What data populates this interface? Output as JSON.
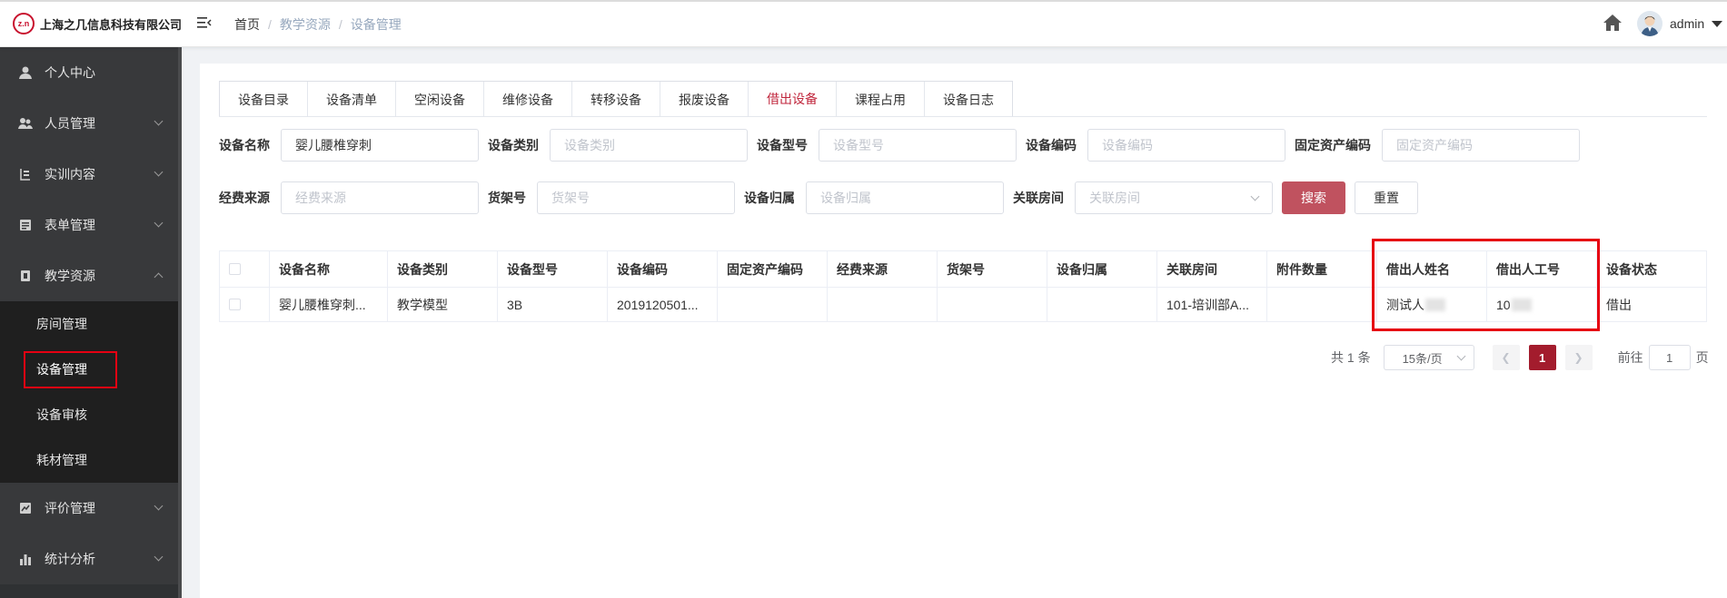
{
  "header": {
    "company_name": "上海之几信息科技有限公司",
    "logo_mark": "z.n",
    "breadcrumb": [
      "首页",
      "教学资源",
      "设备管理"
    ],
    "breadcrumb_sep": "/",
    "user_name": "admin"
  },
  "sidebar": {
    "items": [
      {
        "label": "个人中心",
        "icon": "user-icon"
      },
      {
        "label": "人员管理",
        "icon": "users-icon"
      },
      {
        "label": "实训内容",
        "icon": "training-icon"
      },
      {
        "label": "表单管理",
        "icon": "form-icon"
      },
      {
        "label": "教学资源",
        "icon": "resource-icon"
      },
      {
        "label": "评价管理",
        "icon": "evaluation-icon"
      },
      {
        "label": "统计分析",
        "icon": "chart-icon"
      }
    ],
    "sub_items": [
      {
        "label": "房间管理"
      },
      {
        "label": "设备管理"
      },
      {
        "label": "设备审核"
      },
      {
        "label": "耗材管理"
      }
    ]
  },
  "tabs": [
    "设备目录",
    "设备清单",
    "空闲设备",
    "维修设备",
    "转移设备",
    "报废设备",
    "借出设备",
    "课程占用",
    "设备日志"
  ],
  "active_tab": "借出设备",
  "filters": {
    "device_name_label": "设备名称",
    "device_name_value": "婴儿腰椎穿刺",
    "device_type_label": "设备类别",
    "device_type_placeholder": "设备类别",
    "device_model_label": "设备型号",
    "device_model_placeholder": "设备型号",
    "device_code_label": "设备编码",
    "device_code_placeholder": "设备编码",
    "asset_code_label": "固定资产编码",
    "asset_code_placeholder": "固定资产编码",
    "fund_source_label": "经费来源",
    "fund_source_placeholder": "经费来源",
    "shelf_label": "货架号",
    "shelf_placeholder": "货架号",
    "owner_label": "设备归属",
    "owner_placeholder": "设备归属",
    "room_label": "关联房间",
    "room_placeholder": "关联房间",
    "search_label": "搜索",
    "reset_label": "重置"
  },
  "table": {
    "columns": [
      "设备名称",
      "设备类别",
      "设备型号",
      "设备编码",
      "固定资产编码",
      "经费来源",
      "货架号",
      "设备归属",
      "关联房间",
      "附件数量",
      "借出人姓名",
      "借出人工号",
      "设备状态"
    ],
    "rows": [
      {
        "name": "婴儿腰椎穿刺...",
        "type": "教学模型",
        "model": "3B",
        "code": "2019120501...",
        "asset_code": "",
        "fund": "",
        "shelf": "",
        "owner": "",
        "room": "101-培训部A...",
        "attachments": "",
        "borrower_name": "测试人",
        "borrower_id": "10",
        "status": "借出"
      }
    ]
  },
  "pagination": {
    "total_text": "共 1 条",
    "page_size": "15条/页",
    "current_page": "1",
    "goto_label": "前往",
    "goto_value": "1",
    "page_suffix": "页"
  }
}
